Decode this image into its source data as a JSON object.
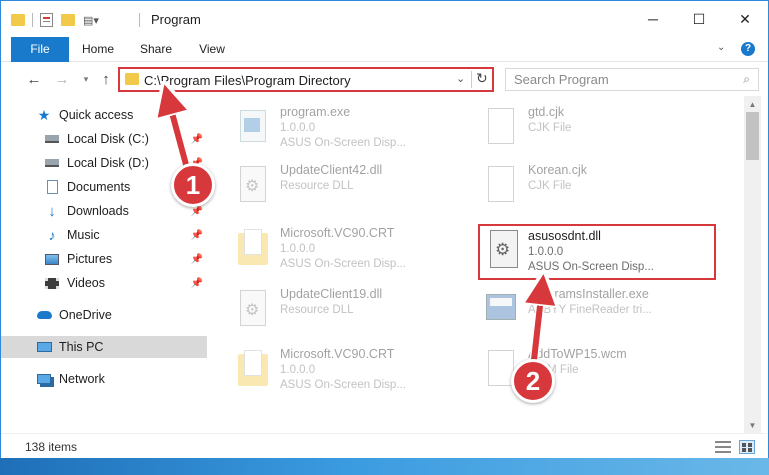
{
  "window": {
    "title": "Program",
    "controls": {
      "minimize": "─",
      "maximize": "☐",
      "close": "✕"
    }
  },
  "ribbon": {
    "tabs": [
      "File",
      "Home",
      "Share",
      "View"
    ],
    "help": "?"
  },
  "address": {
    "path": "C:\\Program Files\\Program Directory",
    "search_placeholder": "Search Program"
  },
  "nav": {
    "items": [
      {
        "label": "Quick access",
        "icon": "star-icon",
        "pinned": false
      },
      {
        "label": "Local Disk (C:)",
        "icon": "drive-icon",
        "pinned": true
      },
      {
        "label": "Local Disk (D:)",
        "icon": "drive-icon",
        "pinned": true
      },
      {
        "label": "Documents",
        "icon": "documents-icon",
        "pinned": true
      },
      {
        "label": "Downloads",
        "icon": "download-icon",
        "pinned": true
      },
      {
        "label": "Music",
        "icon": "music-icon",
        "pinned": true
      },
      {
        "label": "Pictures",
        "icon": "pictures-icon",
        "pinned": true
      },
      {
        "label": "Videos",
        "icon": "videos-icon",
        "pinned": true
      },
      {
        "label": "OneDrive",
        "icon": "cloud-icon",
        "pinned": false
      },
      {
        "label": "This PC",
        "icon": "computer-icon",
        "pinned": false
      },
      {
        "label": "Network",
        "icon": "network-icon",
        "pinned": false
      }
    ]
  },
  "files": [
    {
      "name": "program.exe",
      "line2": "1.0.0.0",
      "line3": "ASUS On-Screen Disp...",
      "icon": "exe-icon"
    },
    {
      "name": "gtd.cjk",
      "line2": "CJK File",
      "line3": "",
      "icon": "file-icon"
    },
    {
      "name": "UpdateClient42.dll",
      "line2": "Resource DLL",
      "line3": "",
      "icon": "dll-icon"
    },
    {
      "name": "Korean.cjk",
      "line2": "CJK File",
      "line3": "",
      "icon": "file-icon"
    },
    {
      "name": "Microsoft.VC90.CRT",
      "line2": "1.0.0.0",
      "line3": "ASUS On-Screen Disp...",
      "icon": "folder-icon"
    },
    {
      "name": "asusosdnt.dll",
      "line2": "1.0.0.0",
      "line3": "ASUS On-Screen Disp...",
      "icon": "dll-icon"
    },
    {
      "name": "UpdateClient19.dll",
      "line2": "Resource DLL",
      "line3": "",
      "icon": "dll-icon"
    },
    {
      "name": "ProgramsInstaller.exe",
      "line2": "ABBYY FineReader tri...",
      "line3": "",
      "icon": "installer-icon"
    },
    {
      "name": "Microsoft.VC90.CRT",
      "line2": "1.0.0.0",
      "line3": "ASUS On-Screen Disp...",
      "icon": "folder-icon"
    },
    {
      "name": "AddToWP15.wcm",
      "line2": "WCM File",
      "line3": "",
      "icon": "file-icon"
    }
  ],
  "status": {
    "count": "138 items"
  },
  "annotations": {
    "badge1": "1",
    "badge2": "2"
  },
  "colors": {
    "accent": "#1979ca",
    "highlight": "#d7383b"
  }
}
